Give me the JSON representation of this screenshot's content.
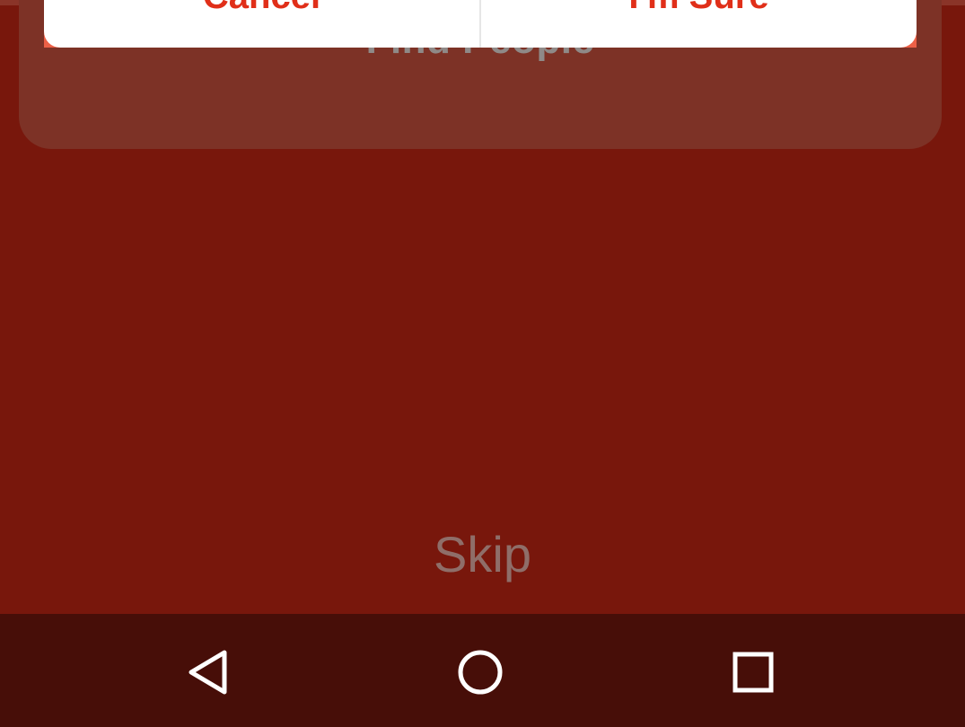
{
  "dialog": {
    "cancel_label": "Cancel",
    "confirm_label": "I'm Sure"
  },
  "card": {
    "title": "Find People"
  },
  "skip_label": "Skip",
  "navbar": {
    "back_icon": "back-triangle-icon",
    "home_icon": "home-circle-icon",
    "recents_icon": "recents-square-icon"
  },
  "colors": {
    "background": "#78170c",
    "card": "#7d3226",
    "dialog_accent": "#ec6046",
    "dialog_text": "#e02f19",
    "navbar": "#470e08"
  }
}
